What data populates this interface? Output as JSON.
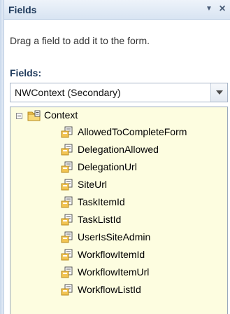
{
  "panel": {
    "title": "Fields",
    "menu_glyph": "▼",
    "close_glyph": "×",
    "hint": "Drag a field to add it to the form.",
    "fields_label": "Fields:",
    "data_source": "NWContext (Secondary)"
  },
  "tree": {
    "root": {
      "label": "Context",
      "icon": "folder-group-icon",
      "expanded": true
    },
    "children": [
      {
        "label": "AllowedToCompleteForm",
        "icon": "field-icon"
      },
      {
        "label": "DelegationAllowed",
        "icon": "field-icon"
      },
      {
        "label": "DelegationUrl",
        "icon": "field-icon"
      },
      {
        "label": "SiteUrl",
        "icon": "field-icon"
      },
      {
        "label": "TaskItemId",
        "icon": "field-icon"
      },
      {
        "label": "TaskListId",
        "icon": "field-icon"
      },
      {
        "label": "UserIsSiteAdmin",
        "icon": "field-icon"
      },
      {
        "label": "WorkflowItemId",
        "icon": "field-icon"
      },
      {
        "label": "WorkflowItemUrl",
        "icon": "field-icon"
      },
      {
        "label": "WorkflowListId",
        "icon": "field-icon"
      }
    ]
  },
  "colors": {
    "tree_background": "#fdfde0",
    "title_text": "#1e395b"
  }
}
